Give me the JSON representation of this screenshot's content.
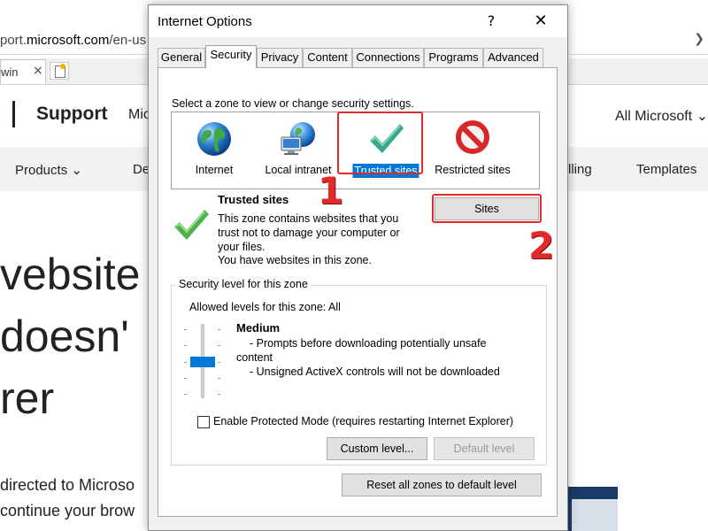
{
  "browser": {
    "url_prefix": "port.",
    "url_domain": "microsoft.com",
    "url_suffix": "/en-us",
    "tab_title": "win",
    "tab_close": "×",
    "header": {
      "support": "Support",
      "partial_nav": "Mic",
      "all_microsoft": "All Microsoft ⌄"
    },
    "nav": {
      "products": "Products ⌄",
      "partial": "De",
      "partial2": "lling",
      "templates": "Templates"
    },
    "hero_lines": [
      "vebsite y",
      "doesn'",
      "rer"
    ],
    "body_lines": [
      "directed to Microso",
      "continue your brow"
    ]
  },
  "dialog": {
    "title": "Internet Options",
    "help": "?",
    "close": "✕",
    "tabs": [
      {
        "label": "General"
      },
      {
        "label": "Security"
      },
      {
        "label": "Privacy"
      },
      {
        "label": "Content"
      },
      {
        "label": "Connections"
      },
      {
        "label": "Programs"
      },
      {
        "label": "Advanced"
      }
    ],
    "security": {
      "zone_caption": "Select a zone to view or change security settings.",
      "zones": [
        {
          "label": "Internet",
          "icon": "globe-icon"
        },
        {
          "label": "Local intranet",
          "icon": "network-globe-icon"
        },
        {
          "label": "Trusted sites",
          "icon": "green-check-icon",
          "selected": true
        },
        {
          "label": "Restricted sites",
          "icon": "no-entry-icon"
        }
      ],
      "zone_name": "Trusted sites",
      "zone_description": "This zone contains websites that you trust not to damage your computer or your files.",
      "zone_status": "You have websites in this zone.",
      "sites_button": "Sites",
      "group_label": "Security level for this zone",
      "allowed_levels": "Allowed levels for this zone: All",
      "level_name": "Medium",
      "level_lines": [
        "- Prompts before downloading potentially unsafe",
        "content",
        "- Unsigned ActiveX controls will not be downloaded"
      ],
      "protected_mode_label": "Enable Protected Mode (requires restarting Internet Explorer)",
      "protected_mode_checked": false,
      "custom_level_button": "Custom level...",
      "default_level_button": "Default level",
      "reset_button": "Reset all zones to default level"
    }
  },
  "annotations": {
    "step1": "1",
    "step2": "2",
    "highlight_color": "#e32a2a"
  },
  "colors": {
    "selection": "#0078d7",
    "check_green": "#3cb14a"
  }
}
